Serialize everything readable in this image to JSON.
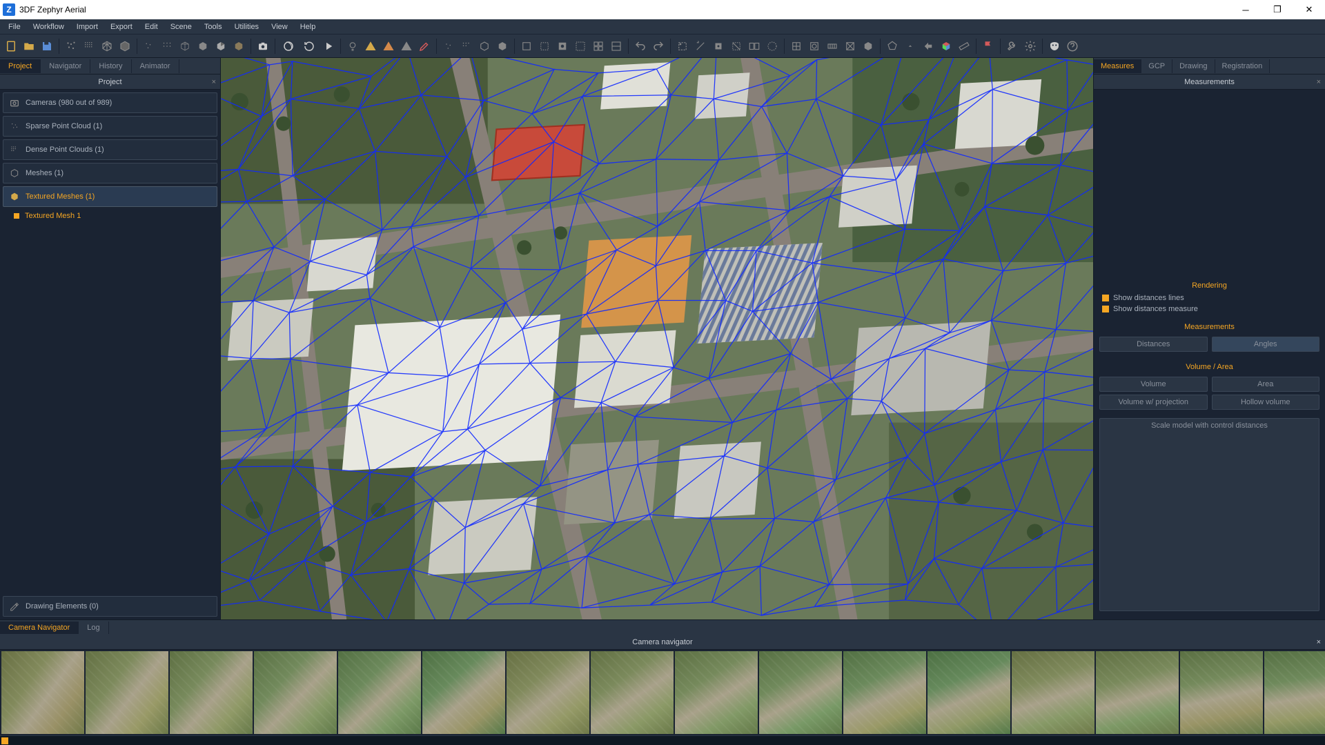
{
  "window": {
    "title": "3DF Zephyr Aerial",
    "app_letter": "Z"
  },
  "menu": [
    "File",
    "Workflow",
    "Import",
    "Export",
    "Edit",
    "Scene",
    "Tools",
    "Utilities",
    "View",
    "Help"
  ],
  "left": {
    "tabs": [
      "Project",
      "Navigator",
      "History",
      "Animator"
    ],
    "active_tab": 0,
    "panel_title": "Project",
    "items": [
      {
        "label": "Cameras (980 out of 989)",
        "icon": "camera"
      },
      {
        "label": "Sparse Point Cloud (1)",
        "icon": "sparse"
      },
      {
        "label": "Dense Point Clouds (1)",
        "icon": "dense"
      },
      {
        "label": "Meshes (1)",
        "icon": "mesh"
      },
      {
        "label": "Textured Meshes (1)",
        "icon": "tex-mesh",
        "selected": true
      }
    ],
    "child": {
      "label": "Textured Mesh 1"
    },
    "drawing": {
      "label": "Drawing Elements (0)"
    }
  },
  "right": {
    "tabs": [
      "Measures",
      "GCP",
      "Drawing",
      "Registration"
    ],
    "active_tab": 0,
    "panel_title": "Measurements",
    "rendering": {
      "title": "Rendering",
      "opt1": "Show distances lines",
      "opt2": "Show distances measure"
    },
    "measurements": {
      "title": "Measurements",
      "distances": "Distances",
      "angles": "Angles"
    },
    "volume": {
      "title": "Volume / Area",
      "volume": "Volume",
      "area": "Area",
      "vol_proj": "Volume w/ projection",
      "hollow": "Hollow volume"
    },
    "scale_btn": "Scale model with control distances"
  },
  "bottom": {
    "tabs": [
      "Camera Navigator",
      "Log"
    ],
    "active_tab": 0,
    "header": "Camera navigator"
  }
}
